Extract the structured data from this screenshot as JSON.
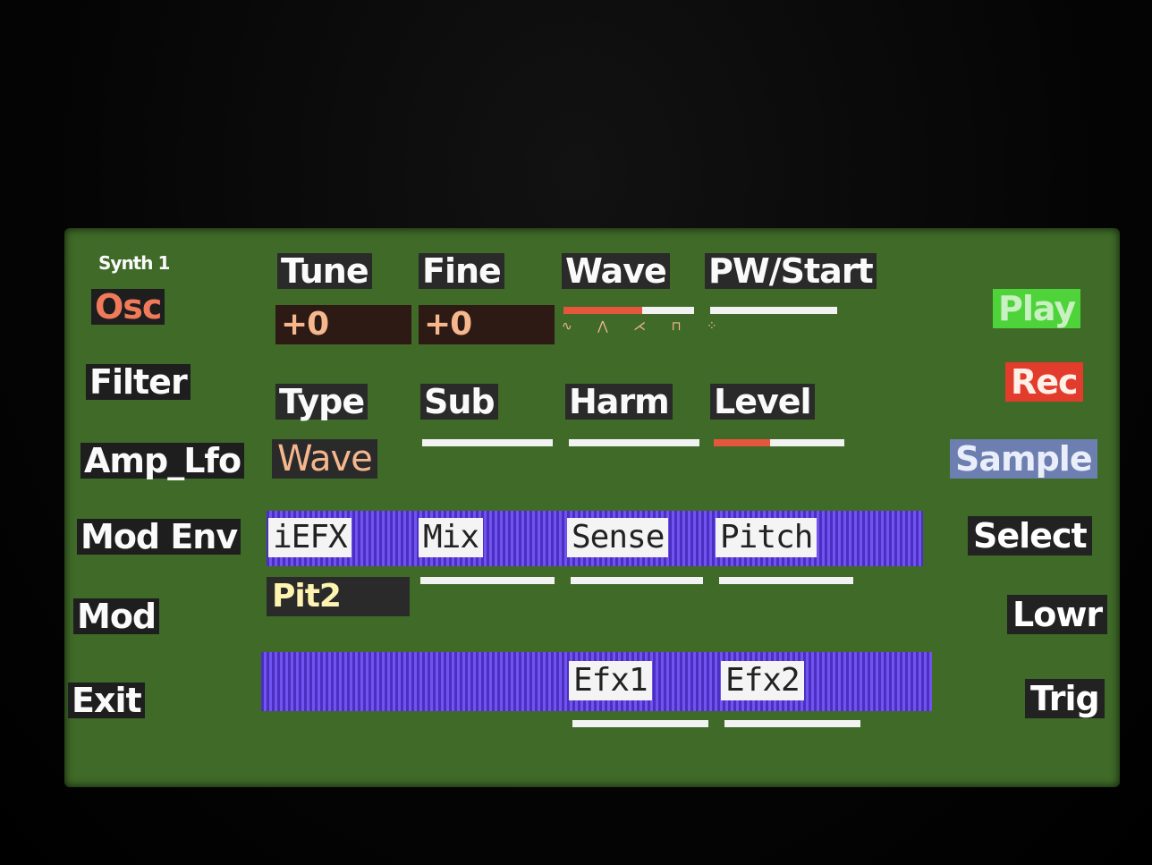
{
  "header": {
    "title": "Synth 1"
  },
  "left_menu": [
    {
      "label": "Osc",
      "active": true
    },
    {
      "label": "Filter"
    },
    {
      "label": "Amp_Lfo"
    },
    {
      "label": "Mod Env"
    },
    {
      "label": "Mod"
    },
    {
      "label": "Exit"
    }
  ],
  "osc_row": {
    "params": [
      {
        "label": "Tune",
        "value": "+0"
      },
      {
        "label": "Fine",
        "value": "+0"
      },
      {
        "label": "Wave",
        "level": 0.6,
        "icons": "∿ ⋀ ⋌ ⊓ ⁘"
      },
      {
        "label": "PW/Start",
        "level": 0.0
      }
    ]
  },
  "sub_row": {
    "params": [
      {
        "label": "Type",
        "value": "Wave"
      },
      {
        "label": "Sub",
        "level": 0.0
      },
      {
        "label": "Harm",
        "level": 0.0
      },
      {
        "label": "Level",
        "level": 0.43
      }
    ]
  },
  "efx_row": {
    "params": [
      {
        "label": "iEFX",
        "value": "Pit2"
      },
      {
        "label": "Mix",
        "level": 0.0
      },
      {
        "label": "Sense",
        "level": 0.0
      },
      {
        "label": "Pitch",
        "level": 0.0
      }
    ]
  },
  "efx_sel_row": {
    "params": [
      {
        "label": "Efx1",
        "level": 0.0
      },
      {
        "label": "Efx2",
        "level": 0.0
      }
    ]
  },
  "right_menu": [
    {
      "label": "Play",
      "style": "play"
    },
    {
      "label": "Rec",
      "style": "rec"
    },
    {
      "label": "Sample",
      "style": "sample"
    },
    {
      "label": "Select",
      "style": "dark"
    },
    {
      "label": "Lowr",
      "style": "dark"
    },
    {
      "label": "Trig",
      "style": "dark"
    }
  ],
  "colors": {
    "screen_bg": "#3f6a28",
    "accent_orange": "#e5573c",
    "band_purple": "#5a3dd9",
    "play_green": "#4ed43a",
    "rec_red": "#e23d2c",
    "sample_blue": "#6c7fb0"
  }
}
